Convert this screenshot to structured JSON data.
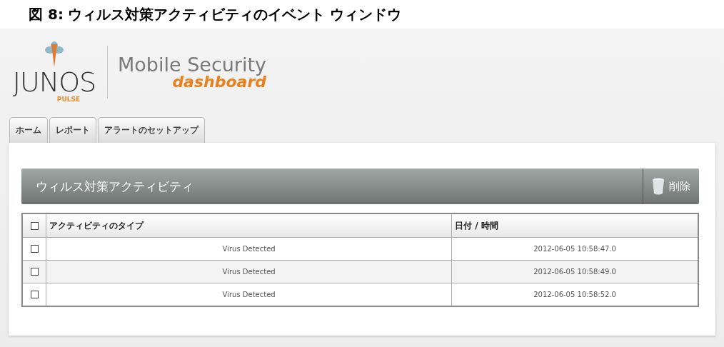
{
  "caption": {
    "figure": "図 8:",
    "title": "ウィルス対策アクティビティのイベント ウィンドウ"
  },
  "logo": {
    "brand": "JUNOS",
    "sub": "PULSE",
    "product": "Mobile Security",
    "product_sub": "dashboard"
  },
  "tabs": [
    {
      "label": "ホーム",
      "selected": false
    },
    {
      "label": "レポート",
      "selected": false
    },
    {
      "label": "アラートのセットアップ",
      "selected": false
    }
  ],
  "panel": {
    "title": "ウィルス対策アクティビティ",
    "delete_button": "削除"
  },
  "table": {
    "select_all_checked": false,
    "columns": [
      "アクティビティのタイプ",
      "日付 / 時間"
    ],
    "rows": [
      {
        "checked": false,
        "cells": [
          "Virus Detected",
          "2012-06-05 10:58:47.0"
        ]
      },
      {
        "checked": false,
        "cells": [
          "Virus Detected",
          "2012-06-05 10:58:49.0"
        ]
      },
      {
        "checked": false,
        "cells": [
          "Virus Detected",
          "2012-06-05 10:58:52.0"
        ]
      }
    ]
  }
}
